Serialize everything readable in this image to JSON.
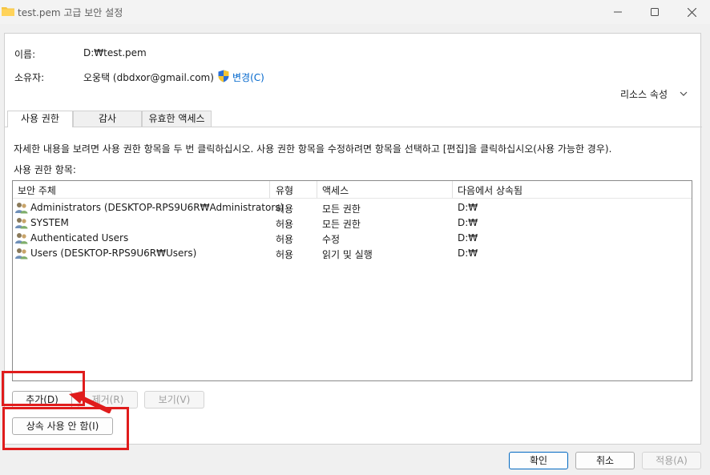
{
  "window": {
    "title": "test.pem 고급 보안 설정"
  },
  "info": {
    "name_label": "이름:",
    "name_value": "D:₩test.pem",
    "owner_label": "소유자:",
    "owner_value": "오웅택 (dbdxor@gmail.com)",
    "change_link": "변경(C)",
    "resource_props": "리소스 속성"
  },
  "tabs": [
    {
      "label": "사용 권한",
      "active": true
    },
    {
      "label": "감사",
      "active": false
    },
    {
      "label": "유효한 액세스",
      "active": false
    }
  ],
  "instructions": "자세한 내용을 보려면 사용 권한 항목을 두 번 클릭하십시오. 사용 권한 항목을 수정하려면 항목을 선택하고 [편집]을 클릭하십시오(사용 가능한 경우).",
  "list_label": "사용 권한 항목:",
  "acl": {
    "columns": [
      "보안 주체",
      "유형",
      "액세스",
      "다음에서 상속됨"
    ],
    "rows": [
      {
        "principal": "Administrators (DESKTOP-RPS9U6R₩Administrators)",
        "type": "허용",
        "access": "모든 권한",
        "inherited": "D:₩"
      },
      {
        "principal": "SYSTEM",
        "type": "허용",
        "access": "모든 권한",
        "inherited": "D:₩"
      },
      {
        "principal": "Authenticated Users",
        "type": "허용",
        "access": "수정",
        "inherited": "D:₩"
      },
      {
        "principal": "Users (DESKTOP-RPS9U6R₩Users)",
        "type": "허용",
        "access": "읽기 및 실행",
        "inherited": "D:₩"
      }
    ]
  },
  "buttons": {
    "add": "추가(D)",
    "remove": "제거(R)",
    "view": "보기(V)",
    "disable_inheritance": "상속 사용 안 함(I)",
    "ok": "확인",
    "cancel": "취소",
    "apply": "적용(A)"
  },
  "icons": {
    "title": "folder-icon",
    "owner_change": "uac-shield-icon",
    "principal": "user-group-icon",
    "resource_props": "chevron-down-icon"
  },
  "colors": {
    "annotation": "#e01c1c",
    "link": "#0066cc",
    "primary_border": "#0067c0"
  }
}
